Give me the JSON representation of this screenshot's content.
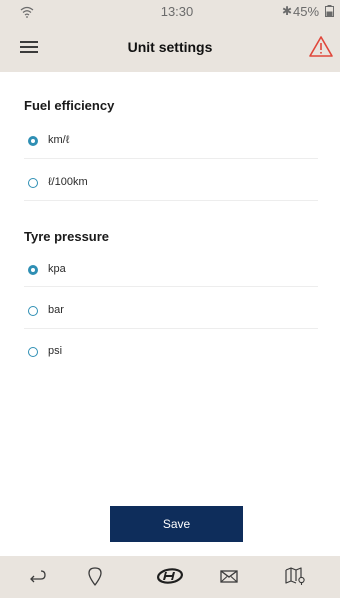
{
  "status_bar": {
    "time": "13:30",
    "battery": "45%",
    "bluetooth_icon": "bluetooth-icon",
    "wifi_icon": "wifi-icon"
  },
  "header": {
    "title": "Unit settings",
    "menu_icon": "hamburger-menu-icon",
    "alert_icon": "warning-triangle-icon"
  },
  "sections": {
    "fuel": {
      "title": "Fuel efficiency",
      "options": [
        {
          "label": "km/ℓ",
          "selected": true
        },
        {
          "label": "ℓ/100km",
          "selected": false
        }
      ]
    },
    "tyre": {
      "title": "Tyre pressure",
      "options": [
        {
          "label": "kpa",
          "selected": true
        },
        {
          "label": "bar",
          "selected": false
        },
        {
          "label": "psi",
          "selected": false
        }
      ]
    }
  },
  "save_label": "Save",
  "bottom_nav": {
    "items": [
      "back-arrow-icon",
      "location-pin-icon",
      "hyundai-logo-icon",
      "mail-icon",
      "map-icon"
    ]
  },
  "colors": {
    "header_bg": "#e9e4de",
    "accent_radio": "#2f8fb4",
    "save_bg": "#0e2d5b",
    "alert": "#e0463a"
  }
}
